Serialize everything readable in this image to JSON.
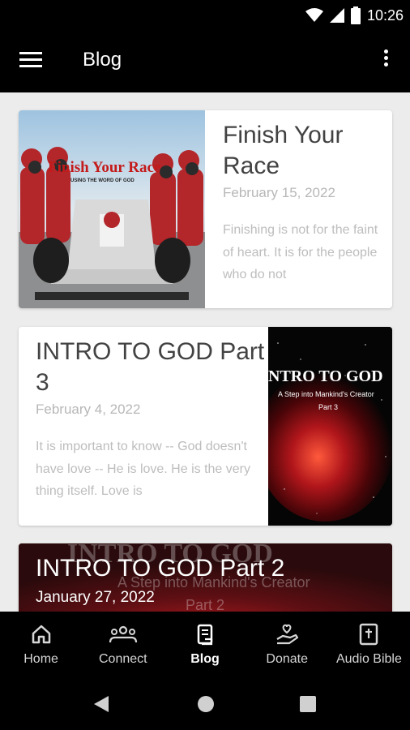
{
  "status": {
    "time": "10:26"
  },
  "appbar": {
    "title": "Blog"
  },
  "posts": [
    {
      "title": "Finish Your Race",
      "date": "February 15, 2022",
      "excerpt": "Finishing is not for the faint of heart. It is for the people who do not",
      "thumb_title": "Finish Your Race",
      "thumb_subtitle": "USING THE WORD OF GOD"
    },
    {
      "title": "INTRO TO GOD Part 3",
      "date": "February 4, 2022",
      "excerpt": "It is important to know -- God doesn't have love -- He is love. He is the very thing itself. Love is",
      "thumb_title": "NTRO TO GOD",
      "thumb_subtitle": "A Step into Mankind's Creator",
      "thumb_part": "Part 3"
    },
    {
      "title": "INTRO TO GOD Part 2",
      "date": "January 27, 2022",
      "bg_title": "INTRO TO GOD",
      "bg_subtitle": "A Step into Mankind's Creator",
      "bg_part": "Part 2"
    }
  ],
  "nav": {
    "home": "Home",
    "connect": "Connect",
    "blog": "Blog",
    "donate": "Donate",
    "audio_bible": "Audio Bible"
  },
  "colors": {
    "bar": "#000000",
    "background": "#ececec",
    "card": "#ffffff",
    "title_text": "#424242",
    "muted_text": "#b7b7b7"
  }
}
